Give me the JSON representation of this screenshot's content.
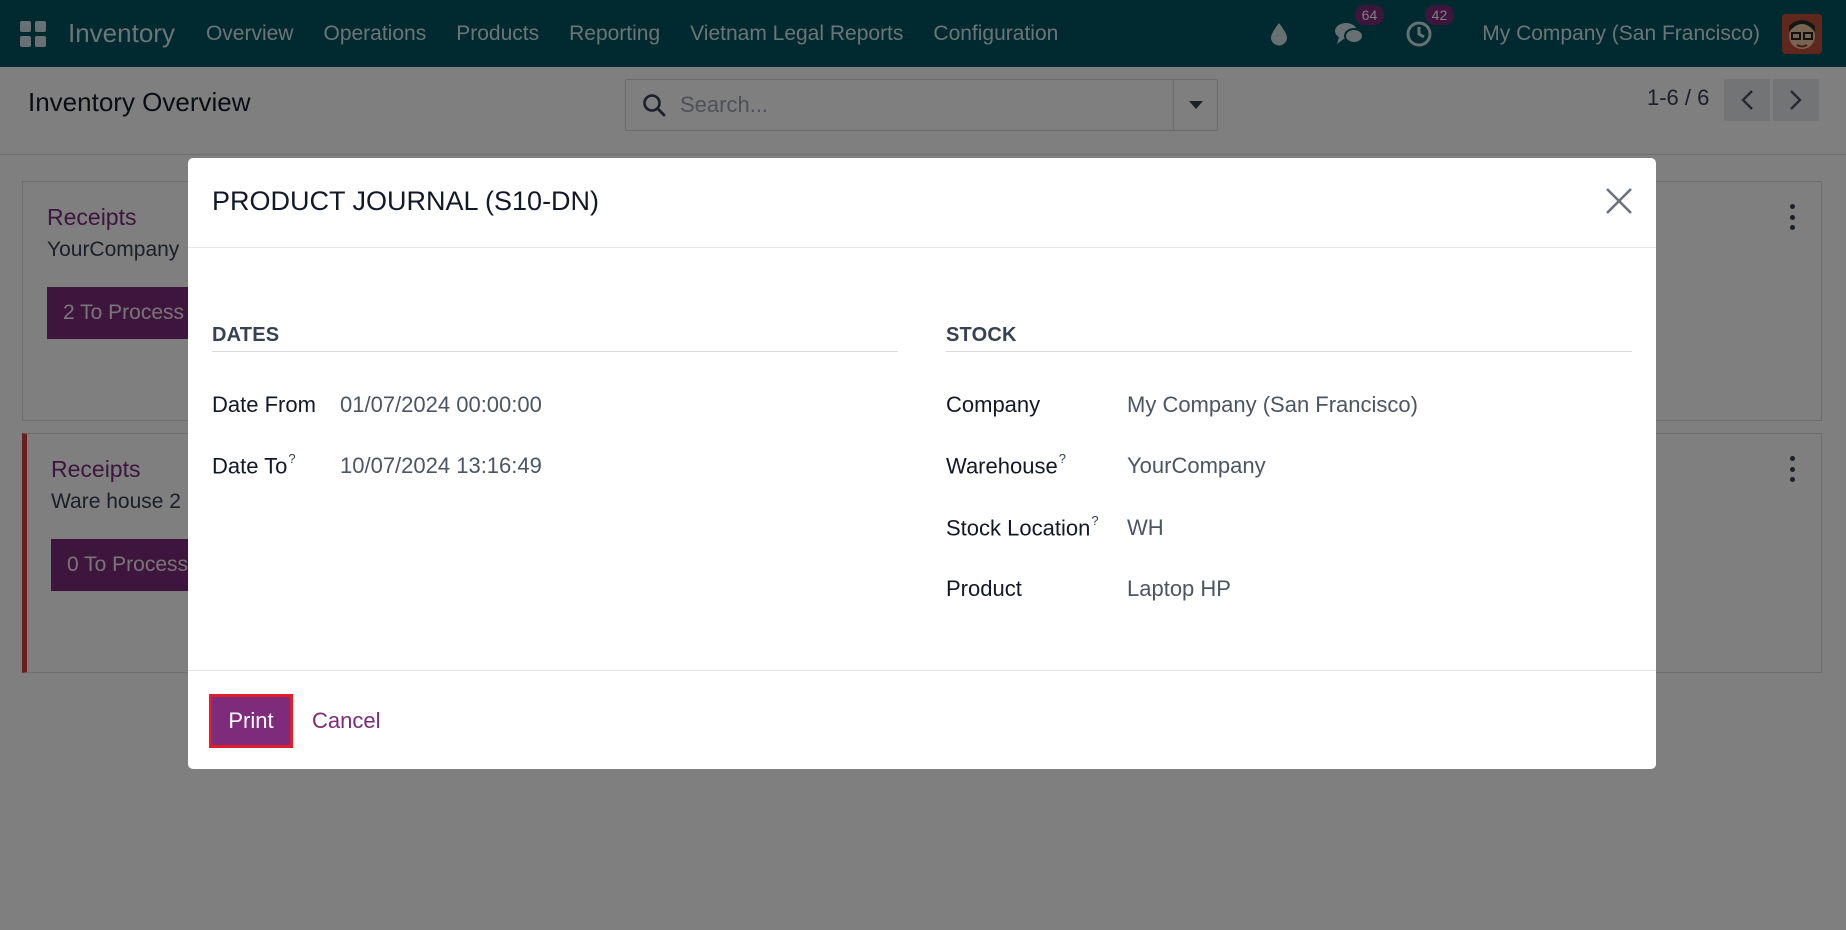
{
  "navbar": {
    "brand": "Inventory",
    "menu": [
      "Overview",
      "Operations",
      "Products",
      "Reporting",
      "Vietnam Legal Reports",
      "Configuration"
    ],
    "messages_count": "64",
    "activities_count": "42",
    "company": "My Company (San Francisco)"
  },
  "control_panel": {
    "title": "Inventory Overview",
    "search_placeholder": "Search...",
    "pager": "1-6 / 6"
  },
  "cards": [
    {
      "title": "Receipts",
      "subtitle": "YourCompany",
      "button": "2 To Process"
    },
    {
      "title": "Receipts",
      "subtitle": "Ware house 2",
      "button": "0 To Process"
    }
  ],
  "modal": {
    "title": "PRODUCT JOURNAL (S10-DN)",
    "dates": {
      "heading": "DATES",
      "date_from_label": "Date From",
      "date_from": "01/07/2024 00:00:00",
      "date_to_label": "Date To",
      "date_to": "10/07/2024 13:16:49"
    },
    "stock": {
      "heading": "STOCK",
      "company_label": "Company",
      "company": "My Company (San Francisco)",
      "warehouse_label": "Warehouse",
      "warehouse": "YourCompany",
      "location_label": "Stock Location",
      "location": "WH",
      "product_label": "Product",
      "product": "Laptop HP"
    },
    "help_marker": "?",
    "print_label": "Print",
    "cancel_label": "Cancel"
  },
  "colors": {
    "navbar": "#01545f",
    "primary": "#7d2b7a",
    "alert": "#d23f3a"
  }
}
